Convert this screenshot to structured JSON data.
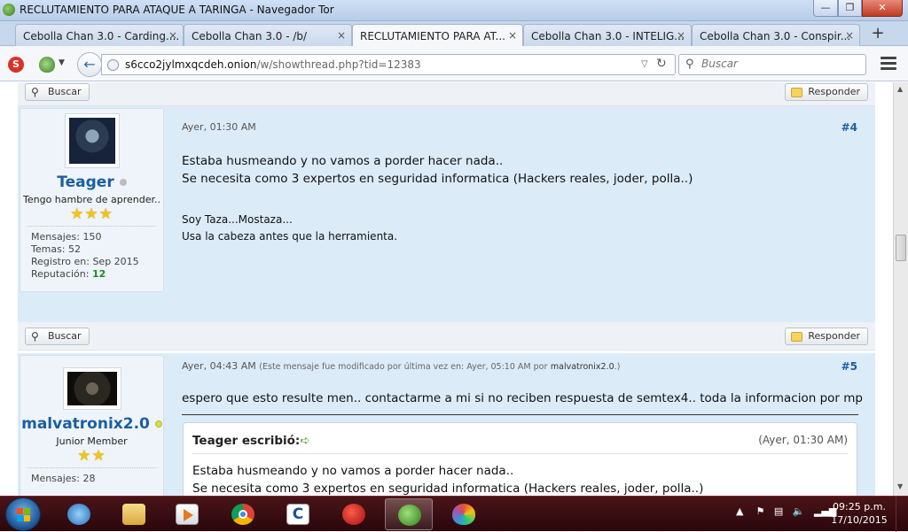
{
  "window": {
    "title": "RECLUTAMIENTO PARA ATAQUE A TARINGA - Navegador Tor",
    "min": "—",
    "max": "❐",
    "close": "✕"
  },
  "tabs": [
    {
      "label": "Cebolla Chan 3.0 - Carding...."
    },
    {
      "label": "Cebolla Chan 3.0 - /b/"
    },
    {
      "label": "RECLUTAMIENTO PARA AT..."
    },
    {
      "label": "Cebolla Chan 3.0 - INTELIG..."
    },
    {
      "label": "Cebolla Chan 3.0 - Conspir..."
    }
  ],
  "tab_close": "×",
  "new_tab": "+",
  "nav": {
    "url_host": "s6cco2jylmxqcdeh.onion",
    "url_path": "/w/showthread.php?tid=12383",
    "search_placeholder": "Buscar"
  },
  "buttons": {
    "search": "Buscar",
    "reply": "Responder"
  },
  "posts": [
    {
      "username": "Teager",
      "online": false,
      "user_title": "Tengo hambre de aprender..",
      "stars": "★★★",
      "messages": "Mensajes: 150",
      "threads": "Temas: 52",
      "registered": "Registro en: Sep 2015",
      "reputation_label": "Reputación:",
      "reputation": "12",
      "date": "Ayer, 01:30 AM",
      "number": "#4",
      "body": [
        "Estaba husmeando y no vamos a porder hacer nada..",
        "Se necesita como 3 expertos en seguridad informatica (Hackers reales, joder, polla..)"
      ],
      "signature": [
        "Soy Taza...Mostaza...",
        "Usa la cabeza antes que la herramienta."
      ]
    },
    {
      "username": "malvatronix2.0",
      "online": true,
      "user_title": "Junior Member",
      "stars": "★★",
      "messages": "Mensajes: 28",
      "date": "Ayer, 04:43 AM",
      "edited_note": "(Este mensaje fue modificado por última vez en: Ayer, 05:10 AM por",
      "editor": "malvatronix2.0",
      "edited_close": ".)",
      "number": "#5",
      "body": [
        "espero que esto resulte men.. contactarme a mi si no reciben respuesta de semtex4.. toda la informacion por mp"
      ],
      "quote": {
        "author": "Teager escribió:",
        "date": "(Ayer, 01:30 AM)",
        "lines": [
          "Estaba husmeando y no vamos a porder hacer nada..",
          "Se necesita como 3 expertos en seguridad informatica (Hackers reales, joder, polla..)"
        ]
      }
    }
  ],
  "taskbar": {
    "time": "09:25 p.m.",
    "date": "17/10/2015"
  },
  "colors": {
    "post_bg": "#dcebf8",
    "username": "#1b5ea0",
    "reputation": "#1e8c1e",
    "taskbar": "#3a0d11"
  }
}
